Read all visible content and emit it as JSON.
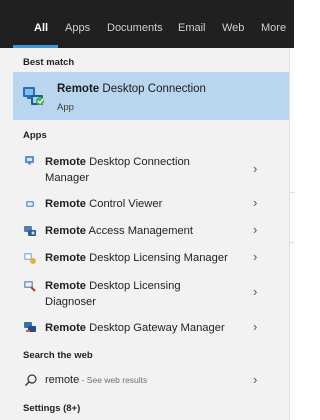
{
  "tabs": [
    {
      "label": "All",
      "active": true
    },
    {
      "label": "Apps"
    },
    {
      "label": "Documents"
    },
    {
      "label": "Email"
    },
    {
      "label": "Web"
    },
    {
      "label": "More"
    }
  ],
  "best_match": {
    "section_label": "Best match",
    "title_bold": "Remote",
    "title_rest": " Desktop Connection",
    "subtitle": "App"
  },
  "apps": {
    "section_label": "Apps",
    "items": [
      {
        "bold": "Remote",
        "rest": " Desktop Connection",
        "line2": "Manager"
      },
      {
        "bold": "Remote",
        "rest": " Control Viewer"
      },
      {
        "bold": "Remote",
        "rest": " Access Management"
      },
      {
        "bold": "Remote",
        "rest": " Desktop Licensing Manager"
      },
      {
        "bold": "Remote",
        "rest": " Desktop Licensing",
        "line2": "Diagnoser"
      },
      {
        "bold": "Remote",
        "rest": " Desktop Gateway Manager"
      }
    ]
  },
  "search_web": {
    "section_label": "Search the web",
    "query": "remote",
    "note": " - See web results"
  },
  "settings": {
    "section_label": "Settings (8+)"
  },
  "colors": {
    "topbar": "#202020",
    "accent": "#3a96dd",
    "selected_row": "#b9d6ee",
    "panel": "#f2f2f2"
  }
}
